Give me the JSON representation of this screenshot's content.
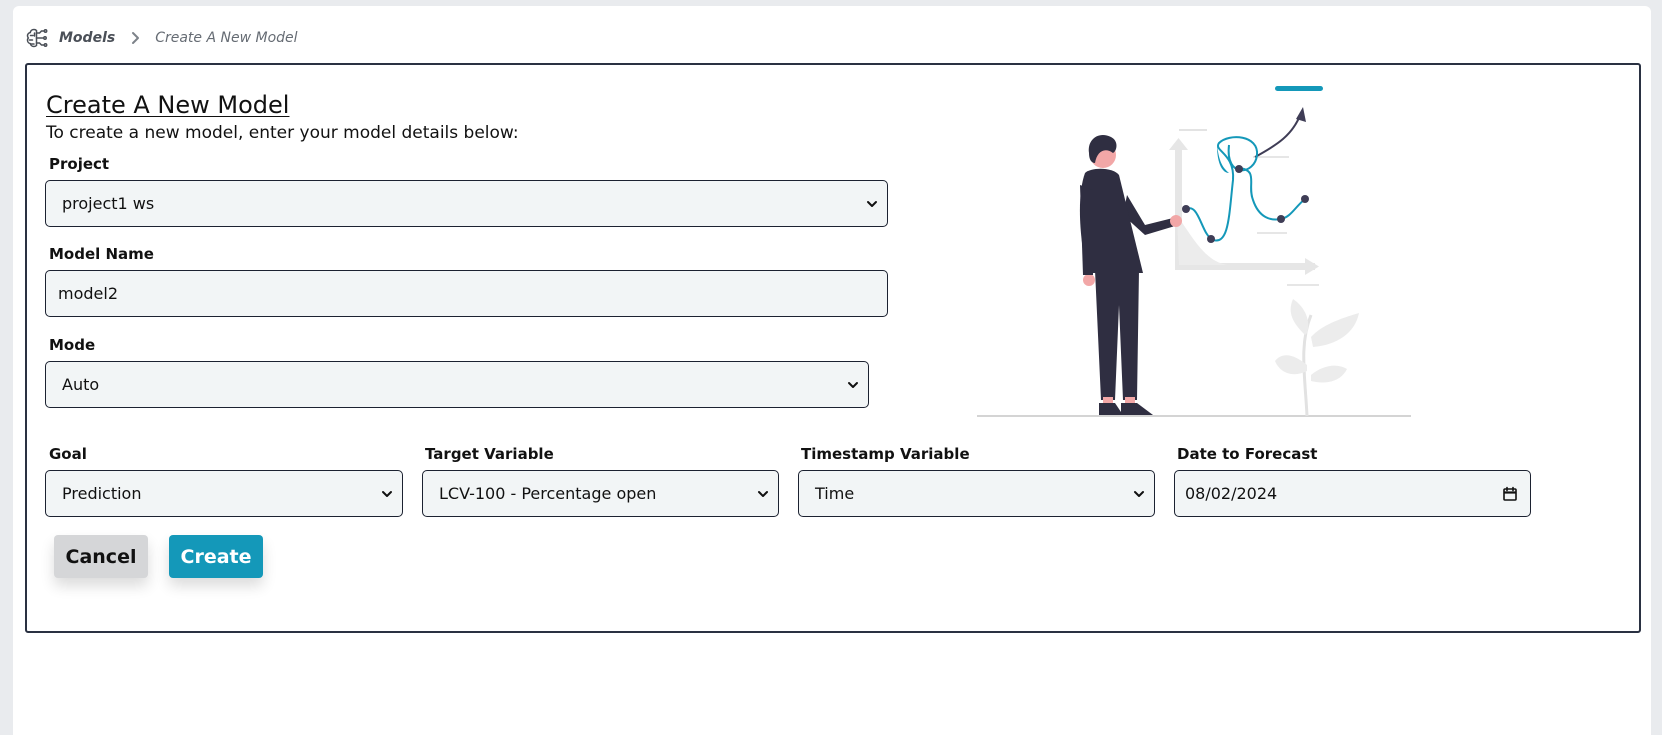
{
  "breadcrumb": {
    "icon": "brain-circuit-icon",
    "root": "Models",
    "separator_icon": "chevron-right-icon",
    "current": "Create A New Model"
  },
  "form": {
    "title": "Create A New Model",
    "subtitle": "To create a new model, enter your model details below:",
    "project": {
      "label": "Project",
      "value": "project1 ws"
    },
    "model_name": {
      "label": "Model Name",
      "value": "model2"
    },
    "mode": {
      "label": "Mode",
      "value": "Auto"
    },
    "goal": {
      "label": "Goal",
      "value": "Prediction"
    },
    "target_variable": {
      "label": "Target Variable",
      "value": "LCV-100 - Percentage open"
    },
    "timestamp_variable": {
      "label": "Timestamp Variable",
      "value": "Time"
    },
    "date_to_forecast": {
      "label": "Date to Forecast",
      "value": "08/02/2024"
    },
    "cancel_label": "Cancel",
    "create_label": "Create"
  },
  "colors": {
    "accent": "#1498b9",
    "border": "#1c2231",
    "field_bg": "#f2f5f6",
    "cancel_bg": "#d5d6d8",
    "figure_dark": "#2f2e41"
  }
}
